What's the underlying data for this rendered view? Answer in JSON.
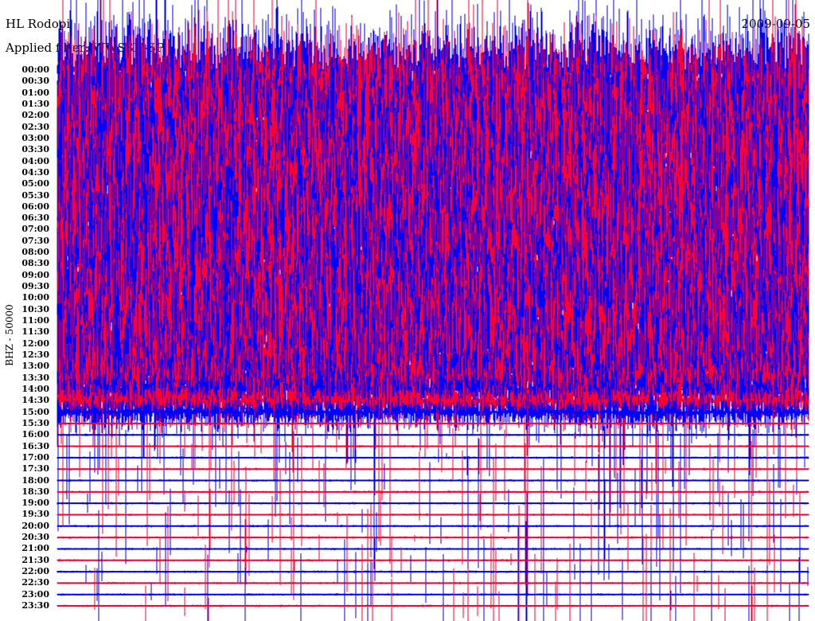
{
  "header": {
    "station": "HL Rodopi",
    "filter": "Applied filter: WWSSN-SP",
    "date": "2009-09-05"
  },
  "chart_data": {
    "type": "line",
    "title": "HL Rodopi",
    "ylabel": "BHZ - 50000",
    "xlabel": "",
    "row_labels": [
      "00:00",
      "00:30",
      "01:00",
      "01:30",
      "02:00",
      "02:30",
      "03:00",
      "03:30",
      "04:00",
      "04:30",
      "05:00",
      "05:30",
      "06:00",
      "06:30",
      "07:00",
      "07:30",
      "08:00",
      "08:30",
      "09:00",
      "09:30",
      "10:00",
      "10:30",
      "11:00",
      "11:30",
      "12:00",
      "12:30",
      "13:00",
      "13:30",
      "14:00",
      "14:30",
      "15:00",
      "15:30",
      "16:00",
      "16:30",
      "17:00",
      "17:30",
      "18:00",
      "18:30",
      "19:00",
      "19:30",
      "20:00",
      "20:30",
      "21:00",
      "21:30",
      "22:00",
      "22:30",
      "23:00",
      "23:30"
    ],
    "relative_amplitude": [
      10,
      10,
      10,
      10,
      10,
      10,
      10,
      10,
      10,
      10,
      10,
      10,
      10,
      10,
      10,
      10,
      10,
      10,
      10,
      10,
      10,
      10,
      10,
      10,
      10,
      10,
      10,
      8,
      6,
      4,
      3,
      0.2,
      0.2,
      0.2,
      0.2,
      0.2,
      0.2,
      0.2,
      0.2,
      0.2,
      0.2,
      0.2,
      0.2,
      0.2,
      0.2,
      0.2,
      0.2,
      0.2
    ],
    "trace_colors": [
      "#0000ff",
      "#ff0033"
    ],
    "minutes_per_row": 30
  }
}
